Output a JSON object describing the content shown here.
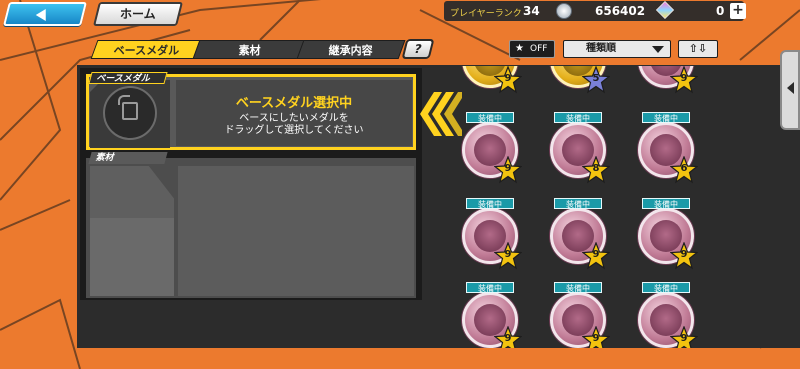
{
  "header": {
    "home_label": "ホーム",
    "rank_label": "プレイヤーランク",
    "rank_value": "34",
    "money_value": "656402",
    "gem_value": "0",
    "plus_label": "+"
  },
  "tabs": [
    {
      "label": "ベースメダル",
      "active": true
    },
    {
      "label": "素材",
      "active": false
    },
    {
      "label": "継承内容",
      "active": false
    }
  ],
  "help_label": "?",
  "controls": {
    "fav_toggle_label": "OFF",
    "sort_label": "種類順",
    "order_label": "⇧⇩"
  },
  "base_panel": {
    "section_label": "ベースメダル",
    "title": "ベースメダル選択中",
    "desc_line1": "ベースにしたいメダルを",
    "desc_line2": "ドラッグして選択してください"
  },
  "material_panel": {
    "section_label": "素材"
  },
  "medals": [
    {
      "kind": "gold",
      "level": "9",
      "tag": ""
    },
    {
      "kind": "gold",
      "level": "5",
      "tag": ""
    },
    {
      "kind": "pink",
      "level": "9",
      "tag": ""
    },
    {
      "kind": "pink",
      "level": "9",
      "tag": "装備中"
    },
    {
      "kind": "pink",
      "level": "8",
      "tag": "装備中"
    },
    {
      "kind": "pink",
      "level": "6",
      "tag": "装備中"
    },
    {
      "kind": "pink",
      "level": "9",
      "tag": "装備中"
    },
    {
      "kind": "pink",
      "level": "9",
      "tag": "装備中"
    },
    {
      "kind": "pink",
      "level": "9",
      "tag": "装備中"
    },
    {
      "kind": "pink",
      "level": "9",
      "tag": "装備中"
    },
    {
      "kind": "pink",
      "level": "9",
      "tag": "装備中"
    },
    {
      "kind": "pink",
      "level": "9",
      "tag": "装備中"
    }
  ],
  "colors": {
    "background": "#ec7a2e",
    "accent_yellow": "#ffd21f",
    "equip_tag": "#1a9aa8",
    "star_gold": "#f2c30f"
  }
}
